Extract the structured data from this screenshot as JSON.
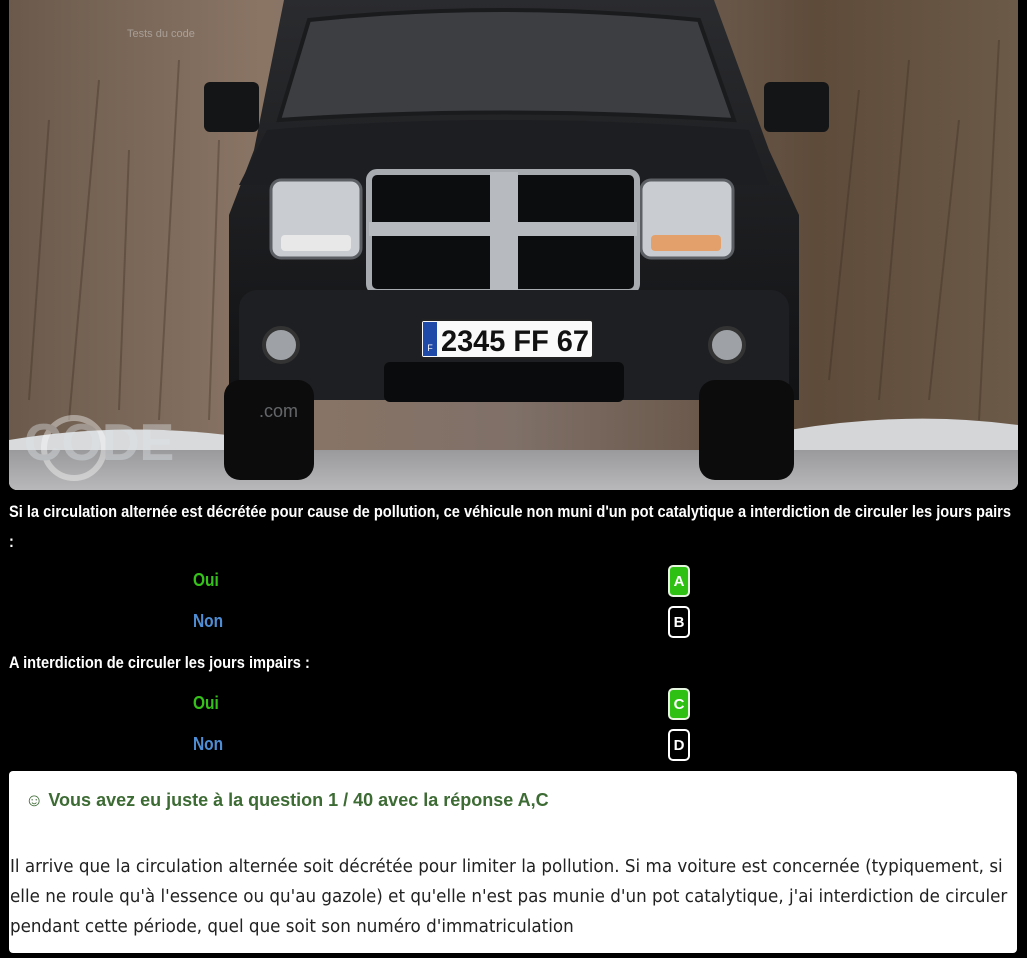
{
  "photo": {
    "plate_text": "2345 FF 67",
    "plate_country": "F",
    "watermark_text": "CODE",
    "watermark_domain": ".com",
    "watermark_tagline": "Tests du code"
  },
  "question1": {
    "text": "Si la circulation alternée est décrétée pour cause de pollution, ce véhicule non muni d'un pot catalytique a interdiction de circuler les jours pairs :",
    "answers": [
      {
        "label": "Oui",
        "letter": "A",
        "selected": true
      },
      {
        "label": "Non",
        "letter": "B",
        "selected": false
      }
    ]
  },
  "question2": {
    "text": "A interdiction de circuler les jours impairs :",
    "answers": [
      {
        "label": "Oui",
        "letter": "C",
        "selected": true
      },
      {
        "label": "Non",
        "letter": "D",
        "selected": false
      }
    ]
  },
  "result": {
    "icon": "smiley-icon",
    "headline": "Vous avez eu juste à la question 1 / 40 avec la réponse A,C",
    "explanation": "Il arrive que la circulation alternée soit décrétée pour limiter la pollution. Si ma voiture est concernée (typiquement, si elle ne roule qu'à l'essence ou qu'au gazole) et qu'elle n'est pas munie d'un pot catalytique, j'ai interdiction de circuler pendant cette période, quel que soit son numéro d'immatriculation"
  },
  "colors": {
    "oui": "#36c21a",
    "non": "#4f8ed6",
    "selected_button": "#2fc014",
    "result_headline": "#3d6b34"
  }
}
